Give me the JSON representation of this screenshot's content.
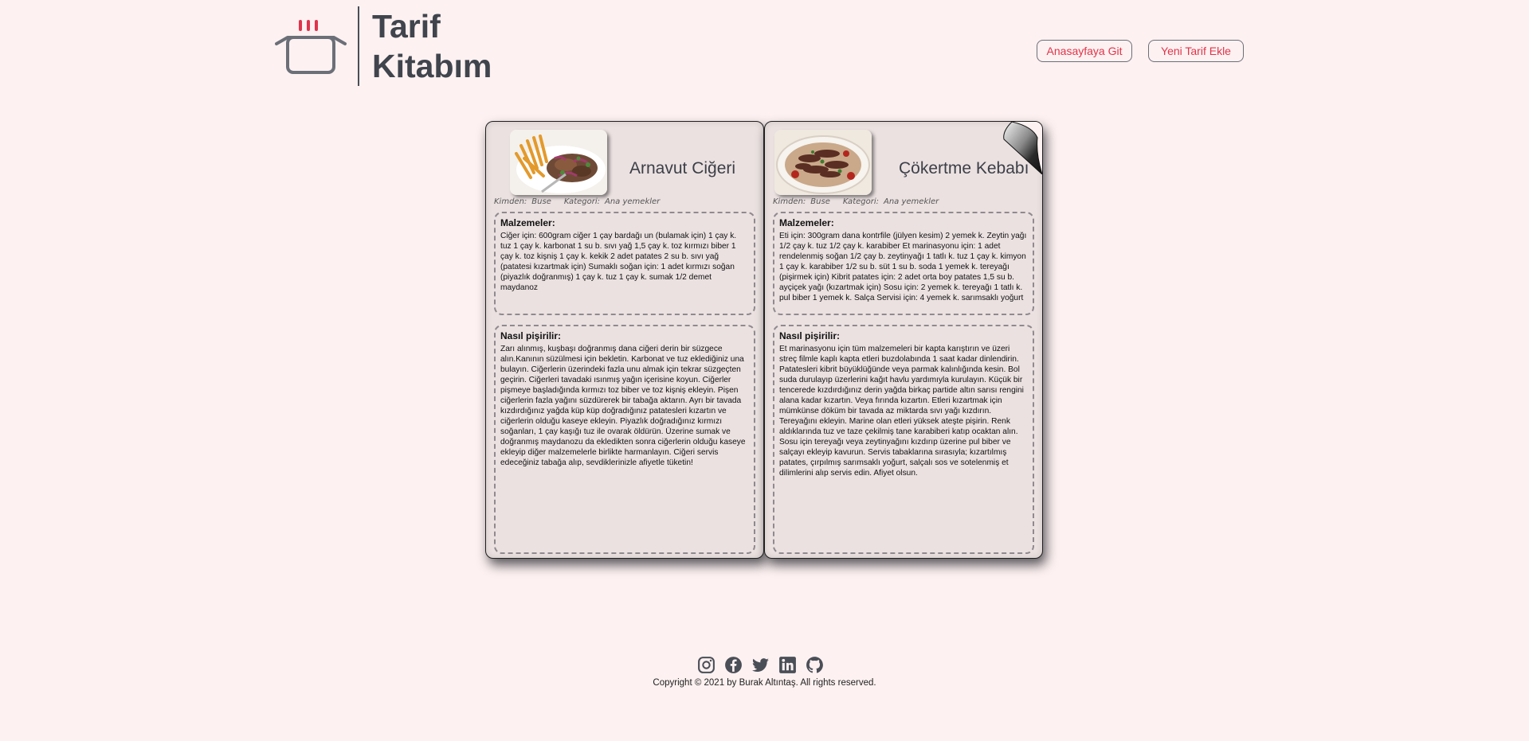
{
  "header": {
    "brand_line1": "Tarif",
    "brand_line2": "Kitabım",
    "nav_home": "Anasayfaya Git",
    "nav_new": "Yeni Tarif Ekle"
  },
  "recipes": [
    {
      "title": "Arnavut Ciğeri",
      "author_label": "Kimden:",
      "author": "Buse",
      "category_label": "Kategori:",
      "category": "Ana yemekler",
      "ingredients_label": "Malzemeler:",
      "ingredients": "Ciğer için: 600gram ciğer 1 çay bardağı un (bulamak için) 1 çay k. tuz 1 çay k. karbonat 1 su b. sıvı yağ 1,5 çay k. toz kırmızı biber 1 çay k. toz kişniş 1 çay k. kekik 2 adet patates 2 su b. sıvı yağ (patatesi kızartmak için) Sumaklı soğan için: 1 adet kırmızı soğan (piyazlık doğranmış) 1 çay k. tuz 1 çay k. sumak 1/2 demet maydanoz",
      "method_label": "Nasıl pişirilir:",
      "method": "Zarı alınmış, kuşbaşı doğranmış dana ciğeri derin bir süzgece alın.Kanının süzülmesi için bekletin. Karbonat ve tuz eklediğiniz una bulayın. Ciğerlerin üzerindeki fazla unu almak için tekrar süzgeçten geçirin. Ciğerleri tavadaki ısınmış yağın içerisine koyun. Ciğerler pişmeye başladığında kırmızı toz biber ve toz kişniş ekleyin. Pişen ciğerlerin fazla yağını süzdürerek bir tabağa aktarın. Ayrı bir tavada kızdırdığınız yağda küp küp doğradığınız patatesleri kızartın ve ciğerlerin olduğu kaseye ekleyin. Piyazlık doğradığınız kırmızı soğanları, 1 çay kaşığı tuz ile ovarak öldürün. Üzerine sumak ve doğranmış maydanozu da ekledikten sonra ciğerlerin olduğu kaseye ekleyip diğer malzemelerle birlikte harmanlayın. Ciğeri servis edeceğiniz tabağa alıp, sevdiklerinizle afiyetle tüketin!"
    },
    {
      "title": "Çökertme Kebabı",
      "author_label": "Kimden:",
      "author": "Buse",
      "category_label": "Kategori:",
      "category": "Ana yemekler",
      "ingredients_label": "Malzemeler:",
      "ingredients": "Eti için: 300gram dana kontrfile (jülyen kesim) 2 yemek k. Zeytin yağı 1/2 çay k. tuz 1/2 çay k. karabiber Et marinasyonu için: 1 adet rendelenmiş soğan 1/2 çay b. zeytinyağı 1 tatlı k. tuz 1 çay k. kimyon 1 çay k. karabiber 1/2 su b. süt 1 su b. soda 1 yemek k. tereyağı (pişirmek için) Kibrit patates için: 2 adet orta boy patates 1,5 su b. ayçiçek yağı (kızartmak için) Sosu için: 2 yemek k. tereyağı 1 tatlı k. pul biber 1 yemek k. Salça Servisi için: 4 yemek k. sarımsaklı yoğurt",
      "method_label": "Nasıl pişirilir:",
      "method": "Et marinasyonu için tüm malzemeleri bir kapta karıştırın ve üzeri streç filmle kaplı kapta etleri buzdolabında 1 saat kadar dinlendirin. Patatesleri kibrit büyüklüğünde veya parmak kalınlığında kesin. Bol suda durulayıp üzerlerini kağıt havlu yardımıyla kurulayın. Küçük bir tencerede kızdırdığınız derin yağda birkaç partide altın sarısı rengini alana kadar kızartın. Veya fırında kızartın. Etleri kızartmak için mümkünse döküm bir tavada az miktarda sıvı yağı kızdırın. Tereyağını ekleyin. Marine olan etleri yüksek ateşte pişirin. Renk aldıklarında tuz ve taze çekilmiş tane karabiberi katıp ocaktan alın. Sosu için tereyağı veya zeytinyağını kızdırıp üzerine pul biber ve salçayı ekleyip kavurun. Servis tabaklarına sırasıyla; kızartılmış patates, çırpılmış sarımsaklı yoğurt, salçalı sos ve sotelenmiş et dilimlerini alıp servis edin. Afiyet olsun."
    }
  ],
  "footer": {
    "copyright": "Copyright © 2021 by Burak Altıntaş. All rights reserved.",
    "social_icons": [
      "instagram-icon",
      "facebook-icon",
      "twitter-icon",
      "linkedin-icon",
      "github-icon"
    ]
  },
  "colors": {
    "background": "#fdf1f1",
    "accent": "#e0344a",
    "page": "#ebe1e1",
    "icon": "#4a4e57"
  }
}
